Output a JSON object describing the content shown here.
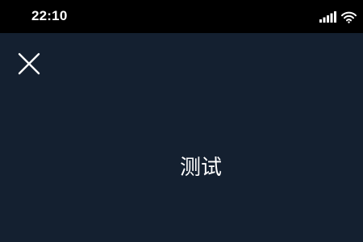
{
  "status_bar": {
    "time": "22:10",
    "signal_icon": "signal-bars-icon",
    "wifi_icon": "wifi-icon"
  },
  "header": {
    "close_icon": "close-icon"
  },
  "main": {
    "text": "测试"
  },
  "colors": {
    "background": "#142030",
    "status_bar": "#000000",
    "foreground": "#ffffff"
  }
}
